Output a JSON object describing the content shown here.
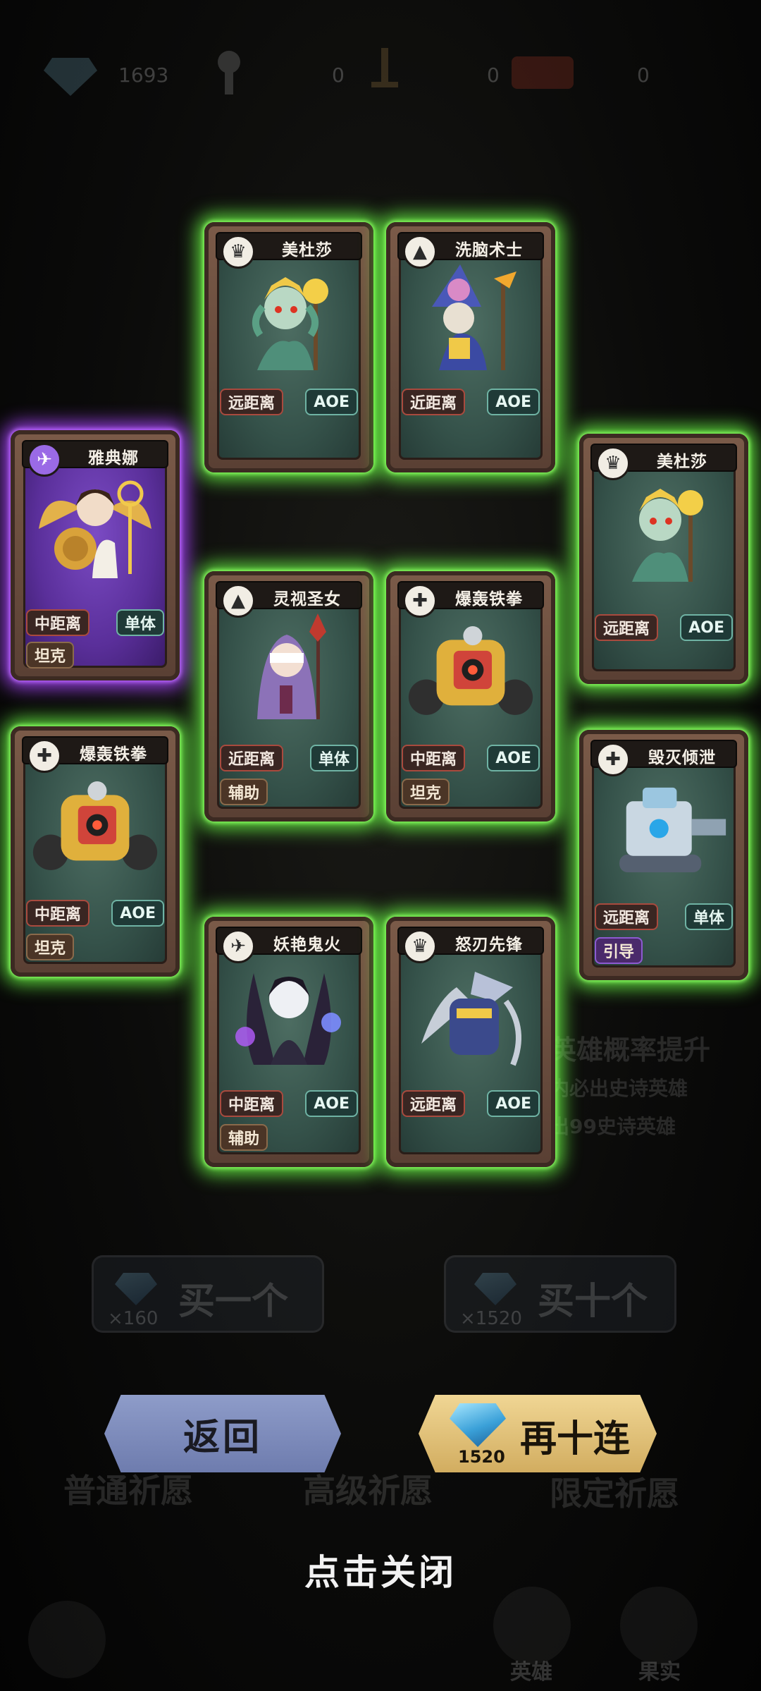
{
  "resources": {
    "gems": "1693",
    "res2": "0",
    "res3": "0",
    "res4": "0"
  },
  "background": {
    "line1": "英雄概率提升",
    "line2": "内必出史诗英雄",
    "line3": "出99史诗英雄",
    "buy_one": "买一个",
    "buy_one_cost": "×160",
    "buy_ten": "买十个",
    "buy_ten_cost": "×1520",
    "tab1": "普通祈愿",
    "tab2": "高级祈愿",
    "tab3": "限定祈愿"
  },
  "cards": [
    {
      "name": "美杜莎",
      "class_icon": "helmet-icon",
      "range": "远距离",
      "type": "AOE",
      "role": ""
    },
    {
      "name": "洗脑术士",
      "class_icon": "mage-icon",
      "range": "近距离",
      "type": "AOE",
      "role": ""
    },
    {
      "name": "雅典娜",
      "class_icon": "wing-icon",
      "range": "中距离",
      "type": "单体",
      "role": "坦克"
    },
    {
      "name": "美杜莎",
      "class_icon": "helmet-icon",
      "range": "远距离",
      "type": "AOE",
      "role": ""
    },
    {
      "name": "灵视圣女",
      "class_icon": "mage-icon",
      "range": "近距离",
      "type": "单体",
      "role": "辅助"
    },
    {
      "name": "爆轰铁拳",
      "class_icon": "wrench-icon",
      "range": "中距离",
      "type": "AOE",
      "role": "坦克"
    },
    {
      "name": "爆轰铁拳",
      "class_icon": "wrench-icon",
      "range": "中距离",
      "type": "AOE",
      "role": "坦克"
    },
    {
      "name": "毁灭倾泄",
      "class_icon": "wrench-icon",
      "range": "远距离",
      "type": "单体",
      "role": "引导"
    },
    {
      "name": "妖艳鬼火",
      "class_icon": "wing-icon",
      "range": "中距离",
      "type": "AOE",
      "role": "辅助"
    },
    {
      "name": "怒刃先锋",
      "class_icon": "helmet-icon",
      "range": "远距离",
      "type": "AOE",
      "role": ""
    }
  ],
  "buttons": {
    "back": "返回",
    "again": "再十连",
    "again_cost": "1520"
  },
  "close_hint": "点击关闭",
  "nav": {
    "heroes": "英雄",
    "fruits": "果实"
  },
  "colors": {
    "rare_glow": "#6cff46",
    "epic_glow": "#aa46ff",
    "back_button": "#8e9cc9",
    "again_button": "#e8c77d"
  }
}
